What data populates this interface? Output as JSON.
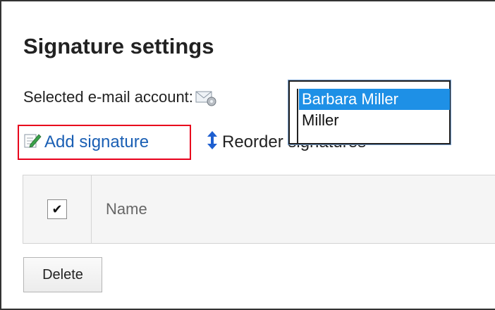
{
  "page": {
    "title": "Signature settings"
  },
  "account": {
    "label": "Selected e-mail account:",
    "icon": "mail-settings-icon",
    "options": [
      {
        "label": "Barbara Miller",
        "selected": true
      },
      {
        "label": "Miller",
        "selected": false
      }
    ]
  },
  "actions": {
    "add_signature": "Add signature",
    "add_icon": "edit-note-icon",
    "reorder_signatures": "Reorder signatures",
    "reorder_icon": "up-down-arrow-icon",
    "highlight_color": "#e8001c",
    "link_color": "#1a5fb4"
  },
  "table": {
    "check_mark": "✔",
    "columns": [
      "Name"
    ]
  },
  "buttons": {
    "delete": "Delete"
  }
}
